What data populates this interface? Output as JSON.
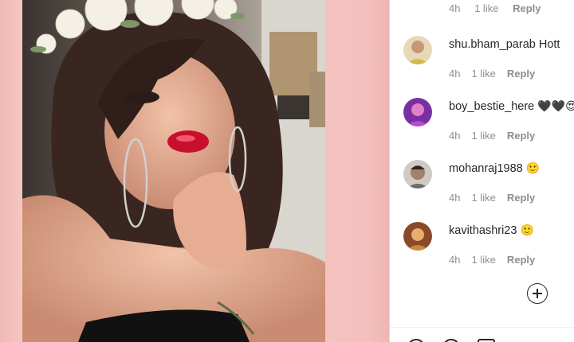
{
  "post": {
    "image_alt": "Selfie photo with flower crown"
  },
  "top_comment_meta": {
    "time": "4h",
    "likes": "1 like",
    "reply": "Reply"
  },
  "comments": [
    {
      "username": "shu.bham_parab",
      "text": "Hott",
      "time": "4h",
      "likes": "1 like",
      "reply": "Reply",
      "avatar_color": "#d8b84a"
    },
    {
      "username": "boy_bestie_here",
      "text": "🖤🖤😍",
      "time": "4h",
      "likes": "1 like",
      "reply": "Reply",
      "avatar_color": "#b64ad9"
    },
    {
      "username": "mohanraj1988",
      "text": "🙂",
      "time": "4h",
      "likes": "1 like",
      "reply": "Reply",
      "avatar_color": "#6f6a66"
    },
    {
      "username": "kavithashri23",
      "text": "🙂",
      "time": "4h",
      "likes": "1 like",
      "reply": "Reply",
      "avatar_color": "#c98a3e"
    }
  ],
  "load_more_icon": "plus-circle-icon",
  "action_icons": [
    "heart-icon",
    "comment-icon",
    "share-icon"
  ]
}
